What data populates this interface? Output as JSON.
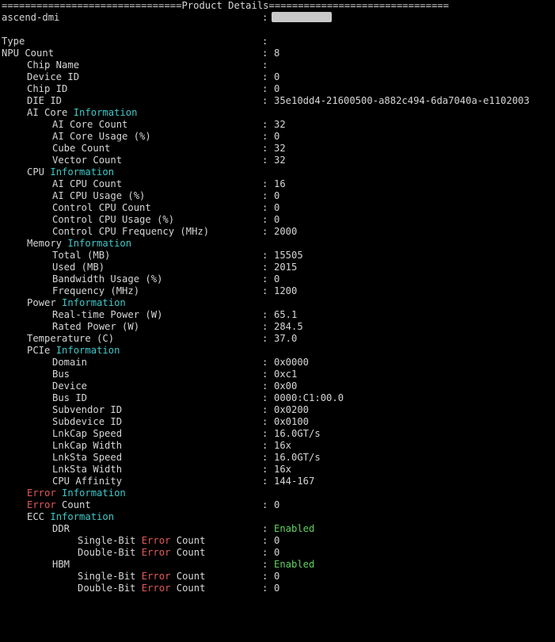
{
  "header": "===============================Product Details===============================",
  "hostname": "ascend-dmi",
  "rows": {
    "type": {
      "label": "Type",
      "value": ""
    },
    "npu_count": {
      "label": "NPU Count",
      "value": "8"
    },
    "chip_name": {
      "label": "Chip Name",
      "value": ""
    },
    "device_id": {
      "label": "Device ID",
      "value": "0"
    },
    "chip_id": {
      "label": "Chip ID",
      "value": "0"
    },
    "die_id": {
      "label": "DIE ID",
      "value": "35e10dd4-21600500-a882c494-6da7040a-e1102003"
    },
    "ai_core_count": {
      "label": "AI Core Count",
      "value": "32"
    },
    "ai_core_usage": {
      "label": "AI Core Usage (%)",
      "value": "0"
    },
    "cube_count": {
      "label": "Cube Count",
      "value": "32"
    },
    "vector_count": {
      "label": "Vector Count",
      "value": "32"
    },
    "ai_cpu_count": {
      "label": "AI CPU Count",
      "value": "16"
    },
    "ai_cpu_usage": {
      "label": "AI CPU Usage (%)",
      "value": "0"
    },
    "control_cpu_count": {
      "label": "Control CPU Count",
      "value": "0"
    },
    "control_cpu_usage": {
      "label": "Control CPU Usage (%)",
      "value": "0"
    },
    "control_cpu_freq": {
      "label": "Control CPU Frequency (MHz)",
      "value": "2000"
    },
    "mem_total": {
      "label": "Total (MB)",
      "value": "15505"
    },
    "mem_used": {
      "label": "Used (MB)",
      "value": "2015"
    },
    "mem_bandwidth": {
      "label": "Bandwidth Usage (%)",
      "value": "0"
    },
    "mem_freq": {
      "label": "Frequency (MHz)",
      "value": "1200"
    },
    "power_realtime": {
      "label": "Real-time Power (W)",
      "value": "65.1"
    },
    "power_rated": {
      "label": "Rated Power (W)",
      "value": "284.5"
    },
    "temperature": {
      "label": "Temperature (C)",
      "value": "37.0"
    },
    "pcie_domain": {
      "label": "Domain",
      "value": "0x0000"
    },
    "pcie_bus": {
      "label": "Bus",
      "value": "0xc1"
    },
    "pcie_device": {
      "label": "Device",
      "value": "0x00"
    },
    "pcie_bus_id": {
      "label": "Bus ID",
      "value": "0000:C1:00.0"
    },
    "pcie_subvendor": {
      "label": "Subvendor ID",
      "value": "0x0200"
    },
    "pcie_subdevice": {
      "label": "Subdevice ID",
      "value": "0x0100"
    },
    "lnkcap_speed": {
      "label": "LnkCap Speed",
      "value": "16.0GT/s"
    },
    "lnkcap_width": {
      "label": "LnkCap Width",
      "value": "16x"
    },
    "lnksta_speed": {
      "label": "LnkSta Speed",
      "value": "16.0GT/s"
    },
    "lnksta_width": {
      "label": "LnkSta Width",
      "value": "16x"
    },
    "cpu_affinity": {
      "label": "CPU Affinity",
      "value": "144-167"
    },
    "error_count": {
      "value": "0"
    },
    "ddr": {
      "label": "DDR",
      "value": "Enabled"
    },
    "ddr_single": {
      "value": "0"
    },
    "ddr_double": {
      "value": "0"
    },
    "hbm": {
      "label": "HBM",
      "value": "Enabled"
    },
    "hbm_single": {
      "value": "0"
    },
    "hbm_double": {
      "value": "0"
    }
  },
  "sections": {
    "ai_core": "AI Core",
    "cpu": "CPU",
    "memory": "Memory",
    "power": "Power",
    "pcie": "PCIe",
    "ecc": "ECC"
  },
  "words": {
    "information": "Information",
    "error": "Error",
    "count": "Count",
    "single_bit": "Single-Bit",
    "double_bit": "Double-Bit",
    "colon": ":"
  },
  "colors": {
    "background": "#000000",
    "text": "#d6d6d6",
    "keyword_cyan": "#3fc8c8",
    "error_red": "#e05a5a",
    "enabled_green": "#5fd35f",
    "redaction": "#c9c9c9"
  }
}
